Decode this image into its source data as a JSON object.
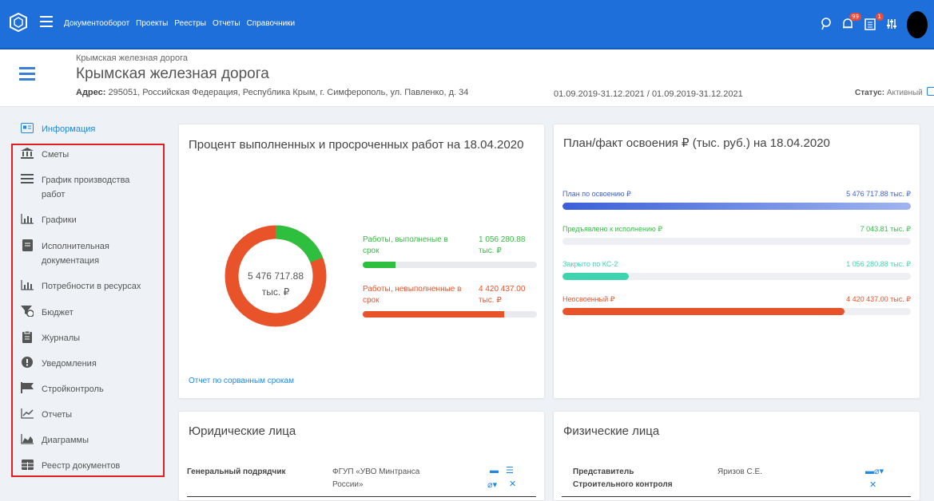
{
  "topbar": {
    "nav": [
      "Документооборот",
      "Проекты",
      "Реестры",
      "Отчеты",
      "Справочники"
    ],
    "notifications_badge": "99",
    "docs_badge": "1"
  },
  "header": {
    "small_title": "Крымская железная дорога",
    "title": "Крымская железная дорога",
    "address_label": "Адрес:",
    "address": "295051, Российская Федерация, Республика Крым, г. Симферополь, ул. Павленко, д. 34",
    "dates": "01.09.2019-31.12.2021 / 01.09.2019-31.12.2021",
    "status_label": "Статус:",
    "status_value": "Активный"
  },
  "sidebar": {
    "items": [
      {
        "label": "Информация",
        "icon": "info-card-icon"
      },
      {
        "label": "Сметы",
        "icon": "bank-icon"
      },
      {
        "label": "График производства работ",
        "icon": "list-icon"
      },
      {
        "label": "Графики",
        "icon": "bar-chart-icon"
      },
      {
        "label": "Исполнительная документация",
        "icon": "document-icon"
      },
      {
        "label": "Потребности в ресурсах",
        "icon": "bar-chart-icon"
      },
      {
        "label": "Бюджет",
        "icon": "budget-icon"
      },
      {
        "label": "Журналы",
        "icon": "journal-icon"
      },
      {
        "label": "Уведомления",
        "icon": "alert-icon"
      },
      {
        "label": "Стройконтроль",
        "icon": "flag-icon"
      },
      {
        "label": "Отчеты",
        "icon": "line-chart-icon"
      },
      {
        "label": "Диаграммы",
        "icon": "area-chart-icon"
      },
      {
        "label": "Реестр документов",
        "icon": "table-icon"
      }
    ]
  },
  "progress_card": {
    "title": "Процент выполненных и просроченных работ на 18.04.2020",
    "total_value": "5 476 717.88",
    "total_unit": "тыс. ₽",
    "legend": [
      {
        "label": "Работы, выполненые в срок",
        "value": "1 056 280.88 тыс. ₽",
        "fraction": 0.19,
        "color": "#2fbf3f"
      },
      {
        "label": "Работы, невыполненные в срок",
        "value": "4 420 437.00 тыс. ₽",
        "fraction": 0.81,
        "color": "#e8532a"
      }
    ],
    "link": "Отчет по сорванным срокам"
  },
  "plan_card": {
    "title": "План/факт освоения ₽ (тыс. руб.) на 18.04.2020",
    "rows": [
      {
        "label": "План по освоению ₽",
        "value": "5 476 717.88 тыс. ₽",
        "fraction": 1.0,
        "color": "#3b5fd9",
        "color2": "#9fb4ee",
        "text_color": "#3b5fd9"
      },
      {
        "label": "Предъявлено к исполнению ₽",
        "value": "7 043.81 тыс. ₽",
        "fraction": 0.0,
        "color": "#2fbf3f",
        "color2": "#2fbf3f",
        "text_color": "#2fbf3f"
      },
      {
        "label": "Закрыто по КС-2",
        "value": "1 056 280.88 тыс. ₽",
        "fraction": 0.19,
        "color": "#3fd4b0",
        "color2": "#3fd4b0",
        "text_color": "#3fd4b0"
      },
      {
        "label": "Неосвоенный ₽",
        "value": "4 420 437.00 тыс. ₽",
        "fraction": 0.81,
        "color": "#e8532a",
        "color2": "#e8532a",
        "text_color": "#e8532a"
      }
    ]
  },
  "legal_card": {
    "title": "Юридические лица",
    "key": "Генеральный подрядчик",
    "value": "ФГУП «УВО Минтранса России»"
  },
  "person_card": {
    "title": "Физические лица",
    "key": "Представитель Строительного контроля",
    "value": "Яризов С.Е."
  }
}
